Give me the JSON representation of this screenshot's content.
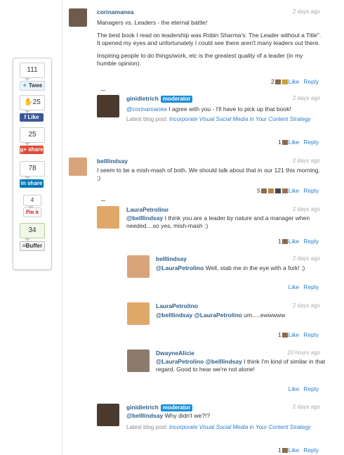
{
  "share": {
    "twitter_count": "111",
    "twitter_label": "Twee",
    "facebook_count": "25",
    "facebook_label": "Like",
    "googleplus_count": "25",
    "googleplus_label": "share",
    "linkedin_count": "78",
    "linkedin_label": "share",
    "pinterest_count": "4",
    "pinterest_label": "Pin it",
    "buffer_count": "34",
    "buffer_label": "Buffer"
  },
  "comments": [
    {
      "author": "corinamanea",
      "time": "2 days ago",
      "paragraphs": [
        "Managers vs. Leaders - the eternal battle!",
        "The best book I read on leadership was Robin Sharma's: The Leader without a Title\". It opened my eyes and unfortunately I could see there aren't many leaders out there.",
        "Inspiring people to do things/work, etc is the greatest quality of a leader (in my humble opinion)."
      ],
      "likes": "2",
      "like_label": "Like",
      "reply_label": "Reply"
    },
    {
      "author": "ginidietrich",
      "badge": "moderator",
      "time": "2 days ago",
      "mention": "@corinamanea",
      "text": " I agree with you - I'll have to pick up that book!",
      "blog_prefix": "Latest blog post: ",
      "blog_link": "Incorporate Visual Social Media in Your Content Strategy",
      "likes": "1",
      "like_label": "Like",
      "reply_label": "Reply"
    },
    {
      "author": "belllindsay",
      "time": "2 days ago",
      "text": "I seem to be a mish-mash of both. We should talk about that in our 121 this morning. ;)",
      "likes": "5",
      "like_label": "Like",
      "reply_label": "Reply"
    },
    {
      "author": "LauraPetrolino",
      "time": "2 days ago",
      "mention": "@belllindsay",
      "text": " I think you are a leader by nature and a manager when needed....so yes, mish-mash :)",
      "likes": "1",
      "like_label": "Like",
      "reply_label": "Reply"
    },
    {
      "author": "belllindsay",
      "time": "2 days ago",
      "mention": "@LauraPetrolino",
      "text": " Well, stab me in the eye with a fork! ;)",
      "like_label": "Like",
      "reply_label": "Reply"
    },
    {
      "author": "LauraPetrolino",
      "time": "2 days ago",
      "mention": "@belllindsay @LauraPetrolino",
      "text": " um.....ewwwww",
      "likes": "1",
      "like_label": "Like",
      "reply_label": "Reply"
    },
    {
      "author": "DwayneAlicie",
      "time": "20 hours ago",
      "mention": "@LauraPetrolino @belllindsay",
      "text": " I think I'm kind of similar in that regard. Good to hear we're not alone!",
      "like_label": "Like",
      "reply_label": "Reply"
    },
    {
      "author": "ginidietrich",
      "badge": "moderator",
      "time": "2 days ago",
      "mention": "@belllindsay",
      "text": " Why didn't we?!?",
      "blog_prefix": "Latest blog post: ",
      "blog_link": "Incorporate Visual Social Media in Your Content Strategy",
      "likes": "1",
      "like_label": "Like",
      "reply_label": "Reply"
    }
  ],
  "colors": {
    "link": "#2c7ec9",
    "author": "#2c5e8a",
    "moderator_badge": "#1a8fd8",
    "facebook": "#3b5998",
    "googleplus": "#dd4b39",
    "linkedin": "#0077b5"
  }
}
